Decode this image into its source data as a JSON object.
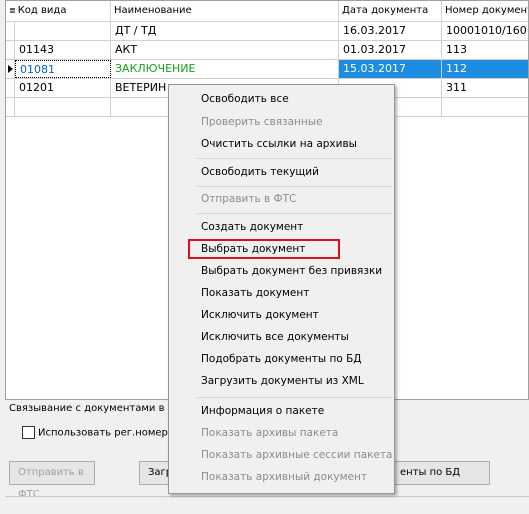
{
  "grid": {
    "columns": [
      "Код вида",
      "Наименование",
      "Дата документа",
      "Номер документа"
    ],
    "rows": [
      {
        "code": "",
        "name": "ДТ / ТД",
        "date": "16.03.2017",
        "number": "10001010/160"
      },
      {
        "code": "01143",
        "name": "АКТ",
        "date": "01.03.2017",
        "number": "113"
      },
      {
        "code": "01081",
        "name": "ЗАКЛЮЧЕНИЕ",
        "date": "15.03.2017",
        "number": "112"
      },
      {
        "code": "01201",
        "name": "ВЕТЕРИН",
        "date": "",
        "number": "311"
      }
    ],
    "selected_row": 2
  },
  "bottom": {
    "section_label": "Связывание с документами в",
    "checkbox_label": "Использовать рег.номер г",
    "buttons": {
      "send_fts": "Отправить в ФТС",
      "load": "Загр",
      "match_db": "енты по БД"
    }
  },
  "context_menu": {
    "items": [
      {
        "label": "Освободить все",
        "enabled": true
      },
      {
        "label": "Проверить связанные",
        "enabled": false
      },
      {
        "label": "Очистить ссылки на архивы",
        "enabled": true
      },
      {
        "label": "Освободить текущий",
        "enabled": true
      },
      {
        "label": "Отправить в ФТС",
        "enabled": false
      },
      {
        "label": "Создать документ",
        "enabled": true
      },
      {
        "label": "Выбрать документ",
        "enabled": true,
        "highlighted": true
      },
      {
        "label": "Выбрать документ без привязки",
        "enabled": true
      },
      {
        "label": "Показать документ",
        "enabled": true
      },
      {
        "label": "Исключить документ",
        "enabled": true
      },
      {
        "label": "Исключить все документы",
        "enabled": true
      },
      {
        "label": "Подобрать документы по БД",
        "enabled": true
      },
      {
        "label": "Загрузить документы из XML",
        "enabled": true
      },
      {
        "label": "Информация о пакете",
        "enabled": true
      },
      {
        "label": "Показать архивы пакета",
        "enabled": false
      },
      {
        "label": "Показать архивные сессии пакета",
        "enabled": false
      },
      {
        "label": "Показать архивный документ",
        "enabled": false
      }
    ]
  },
  "colors": {
    "selection": "#1e8ce0",
    "highlight_box": "#e01010",
    "green_text": "#18a018"
  }
}
